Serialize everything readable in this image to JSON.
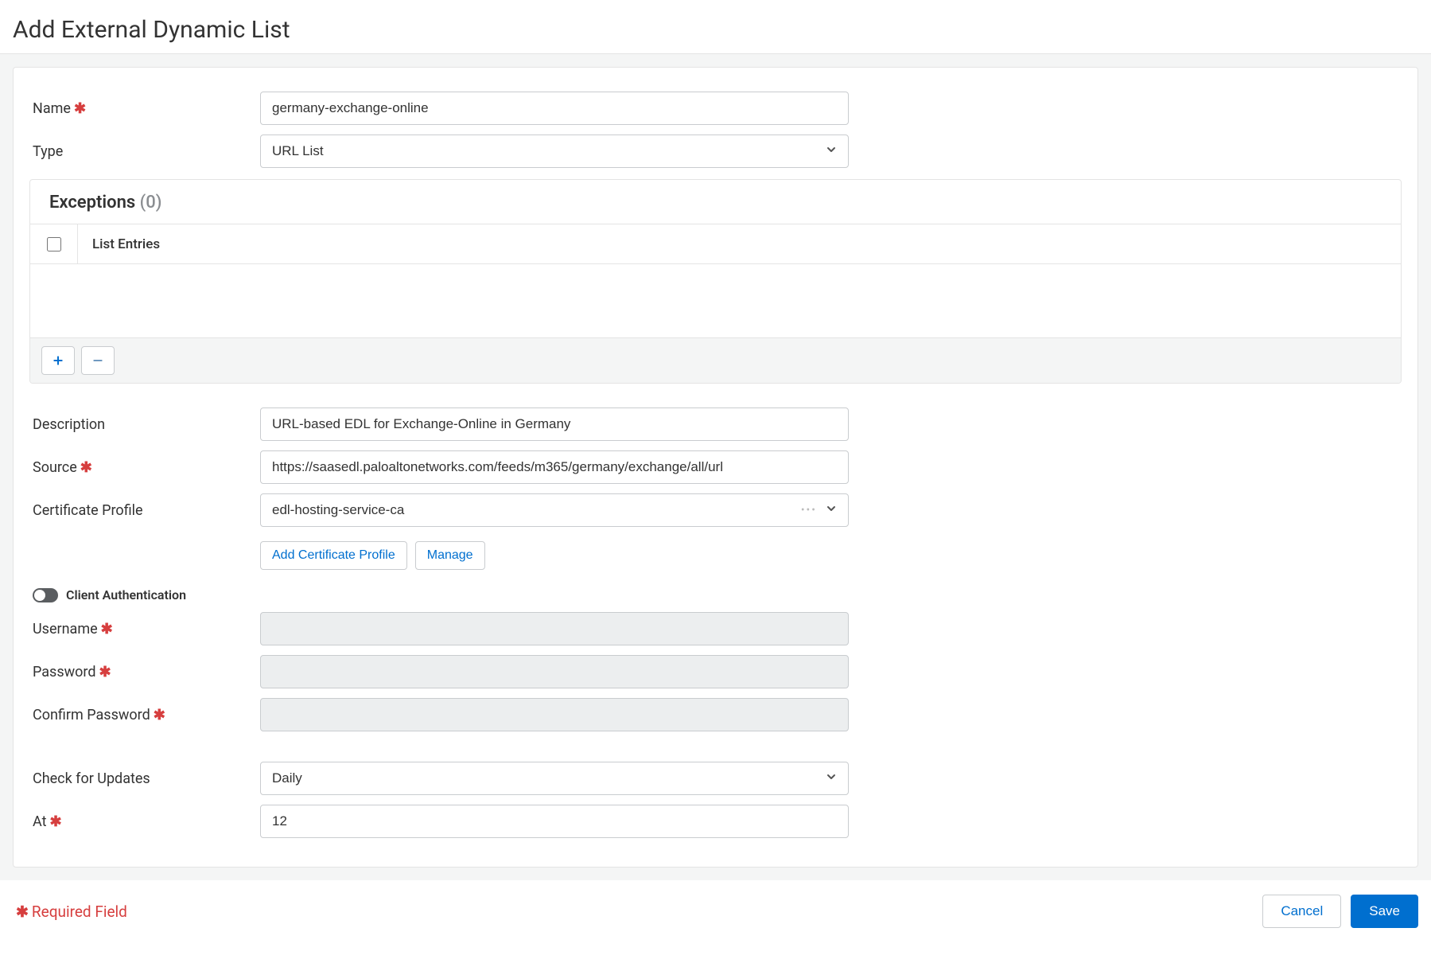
{
  "header": {
    "title": "Add External Dynamic List"
  },
  "labels": {
    "name": "Name",
    "type": "Type",
    "description": "Description",
    "source": "Source",
    "cert_profile": "Certificate Profile",
    "client_auth": "Client Authentication",
    "username": "Username",
    "password": "Password",
    "confirm_password": "Confirm Password",
    "check_updates": "Check for Updates",
    "at": "At"
  },
  "values": {
    "name": "germany-exchange-online",
    "type": "URL List",
    "description": "URL-based EDL for Exchange-Online in Germany",
    "source": "https://saasedl.paloaltonetworks.com/feeds/m365/germany/exchange/all/url",
    "cert_profile": "edl-hosting-service-ca",
    "check_updates": "Daily",
    "at": "12"
  },
  "exceptions": {
    "title": "Exceptions",
    "count": "(0)",
    "col_header": "List Entries"
  },
  "buttons": {
    "add_cert": "Add Certificate Profile",
    "manage": "Manage",
    "cancel": "Cancel",
    "save": "Save"
  },
  "footer": {
    "required_note": "Required Field"
  }
}
